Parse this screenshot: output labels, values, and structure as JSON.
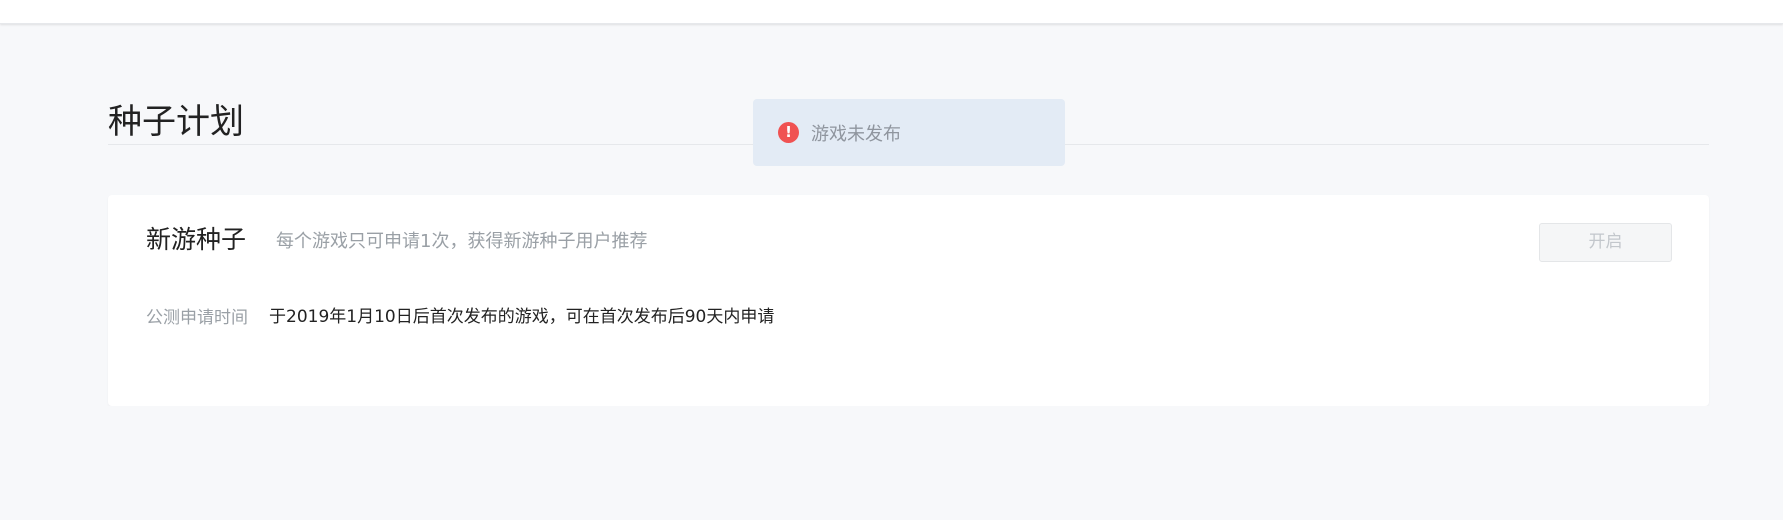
{
  "page": {
    "title": "种子计划"
  },
  "toast": {
    "icon": "error-icon",
    "icon_glyph": "!",
    "message": "游戏未发布",
    "background": "#e3ebf5",
    "icon_color": "#f05252"
  },
  "card": {
    "title": "新游种子",
    "subtitle": "每个游戏只可申请1次，获得新游种子用户推荐",
    "open_button_label": "开启",
    "info": {
      "label": "公测申请时间",
      "value": "于2019年1月10日后首次发布的游戏，可在首次发布后90天内申请"
    }
  }
}
